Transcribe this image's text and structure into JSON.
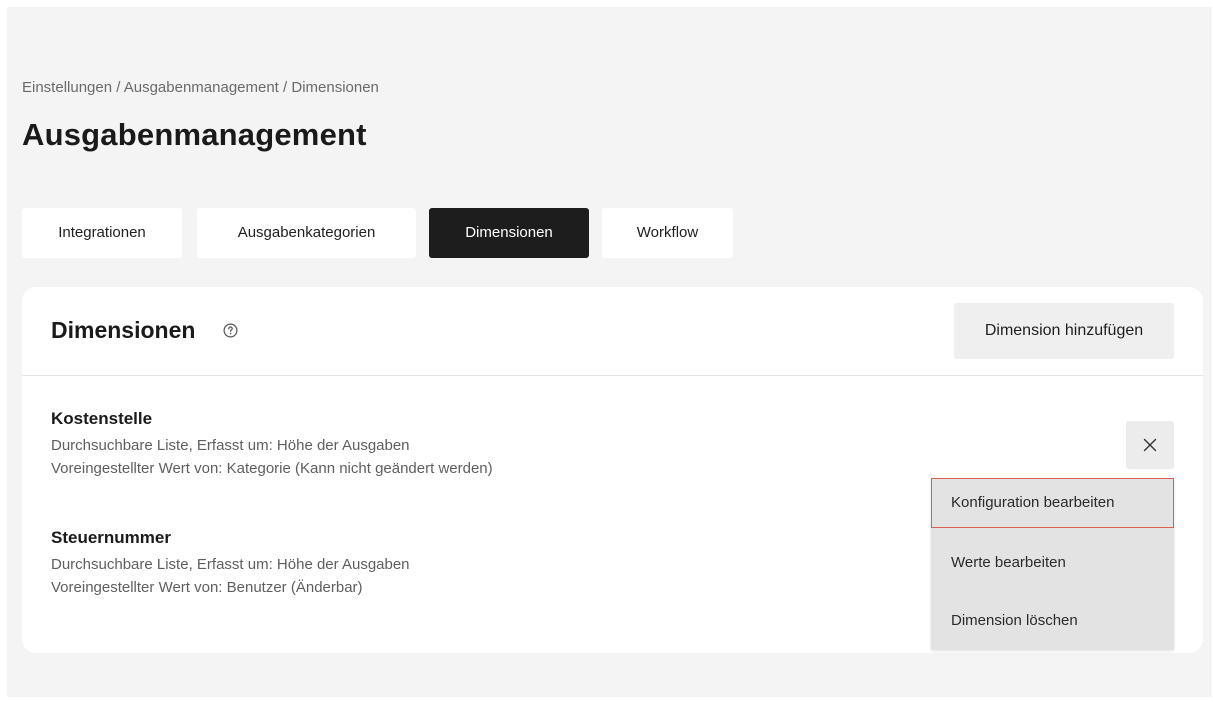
{
  "breadcrumb": "Einstellungen / Ausgabenmanagement / Dimensionen",
  "page_title": "Ausgabenmanagement",
  "tabs": [
    {
      "label": "Integrationen",
      "active": false
    },
    {
      "label": "Ausgabenkategorien",
      "active": false
    },
    {
      "label": "Dimensionen",
      "active": true
    },
    {
      "label": "Workflow",
      "active": false
    }
  ],
  "card": {
    "title": "Dimensionen",
    "help_icon": "question-circle-icon",
    "add_button_label": "Dimension hinzufügen",
    "close_icon": "close-icon"
  },
  "dimensions": [
    {
      "name": "Kostenstelle",
      "line1": "Durchsuchbare Liste, Erfasst um: Höhe der Ausgaben",
      "line2": "Voreingestellter Wert von: Kategorie (Kann nicht geändert werden)"
    },
    {
      "name": "Steuernummer",
      "line1": "Durchsuchbare Liste, Erfasst um: Höhe der Ausgaben",
      "line2": "Voreingestellter Wert von: Benutzer (Änderbar)"
    }
  ],
  "menu": {
    "items": [
      {
        "label": "Konfiguration bearbeiten",
        "highlighted": true
      },
      {
        "label": "Werte bearbeiten",
        "highlighted": false
      },
      {
        "label": "Dimension löschen",
        "highlighted": false
      }
    ]
  },
  "colors": {
    "page_background": "#f4f4f4",
    "active_tab": "#1d1d1d",
    "highlight_border": "#d9604c",
    "menu_background": "#e3e3e3"
  }
}
